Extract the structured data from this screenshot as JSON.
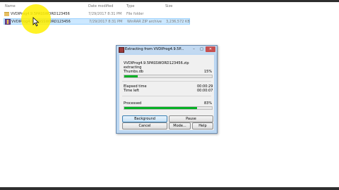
{
  "explorer": {
    "columns": {
      "name": "Name",
      "date": "Date modified",
      "type": "Type",
      "size": "Size"
    },
    "rows": [
      {
        "name": "VVDIProg4.9.5PASSWORD123456",
        "date": "7/29/2017 8:31 PM",
        "type": "File folder",
        "size": ""
      },
      {
        "name": "VVDIProg4.9.5PASSWORD123456",
        "date": "7/29/2017 8:31 PM",
        "type": "WinRAR ZIP archive",
        "size": "3,236,572 KB"
      }
    ]
  },
  "dialog": {
    "title": "Extracting from VVDIProg4.9.5P...",
    "archive": "VVDIProg4.9.5PASSWORD123456.zip",
    "action": "extracting",
    "current_file": "Thumbs.db",
    "file_percent": "15%",
    "file_progress": 0.15,
    "elapsed_label": "Elapsed time",
    "elapsed_value": "00:00:29",
    "timeleft_label": "Time left",
    "timeleft_value": "00:00:07",
    "processed_label": "Processed",
    "processed_percent": "83%",
    "processed_progress": 0.83,
    "buttons": {
      "background": "Background",
      "pause": "Pause",
      "cancel": "Cancel",
      "mode": "Mode...",
      "help": "Help"
    },
    "window_buttons": {
      "minimize": "–",
      "maximize": "□",
      "close": "✕"
    }
  },
  "colors": {
    "progress": "#06b025",
    "selection": "#cce8ff",
    "highlight": "#fff000"
  },
  "icons": [
    "folder-icon",
    "zip-archive-icon",
    "winrar-icon",
    "mouse-cursor-icon"
  ]
}
